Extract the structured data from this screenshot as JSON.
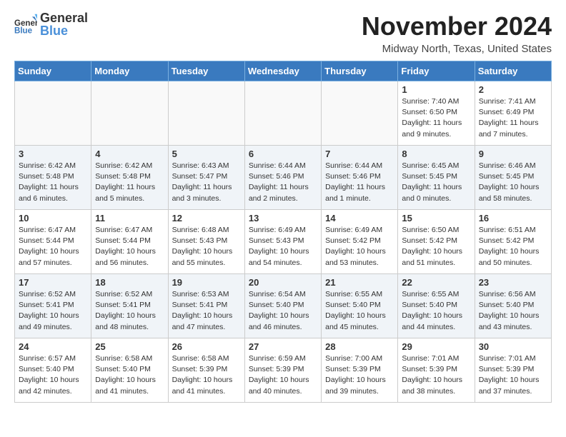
{
  "logo": {
    "line1": "General",
    "line2": "Blue"
  },
  "title": "November 2024",
  "location": "Midway North, Texas, United States",
  "weekdays": [
    "Sunday",
    "Monday",
    "Tuesday",
    "Wednesday",
    "Thursday",
    "Friday",
    "Saturday"
  ],
  "weeks": [
    [
      {
        "day": "",
        "detail": ""
      },
      {
        "day": "",
        "detail": ""
      },
      {
        "day": "",
        "detail": ""
      },
      {
        "day": "",
        "detail": ""
      },
      {
        "day": "",
        "detail": ""
      },
      {
        "day": "1",
        "detail": "Sunrise: 7:40 AM\nSunset: 6:50 PM\nDaylight: 11 hours\nand 9 minutes."
      },
      {
        "day": "2",
        "detail": "Sunrise: 7:41 AM\nSunset: 6:49 PM\nDaylight: 11 hours\nand 7 minutes."
      }
    ],
    [
      {
        "day": "3",
        "detail": "Sunrise: 6:42 AM\nSunset: 5:48 PM\nDaylight: 11 hours\nand 6 minutes."
      },
      {
        "day": "4",
        "detail": "Sunrise: 6:42 AM\nSunset: 5:48 PM\nDaylight: 11 hours\nand 5 minutes."
      },
      {
        "day": "5",
        "detail": "Sunrise: 6:43 AM\nSunset: 5:47 PM\nDaylight: 11 hours\nand 3 minutes."
      },
      {
        "day": "6",
        "detail": "Sunrise: 6:44 AM\nSunset: 5:46 PM\nDaylight: 11 hours\nand 2 minutes."
      },
      {
        "day": "7",
        "detail": "Sunrise: 6:44 AM\nSunset: 5:46 PM\nDaylight: 11 hours\nand 1 minute."
      },
      {
        "day": "8",
        "detail": "Sunrise: 6:45 AM\nSunset: 5:45 PM\nDaylight: 11 hours\nand 0 minutes."
      },
      {
        "day": "9",
        "detail": "Sunrise: 6:46 AM\nSunset: 5:45 PM\nDaylight: 10 hours\nand 58 minutes."
      }
    ],
    [
      {
        "day": "10",
        "detail": "Sunrise: 6:47 AM\nSunset: 5:44 PM\nDaylight: 10 hours\nand 57 minutes."
      },
      {
        "day": "11",
        "detail": "Sunrise: 6:47 AM\nSunset: 5:44 PM\nDaylight: 10 hours\nand 56 minutes."
      },
      {
        "day": "12",
        "detail": "Sunrise: 6:48 AM\nSunset: 5:43 PM\nDaylight: 10 hours\nand 55 minutes."
      },
      {
        "day": "13",
        "detail": "Sunrise: 6:49 AM\nSunset: 5:43 PM\nDaylight: 10 hours\nand 54 minutes."
      },
      {
        "day": "14",
        "detail": "Sunrise: 6:49 AM\nSunset: 5:42 PM\nDaylight: 10 hours\nand 53 minutes."
      },
      {
        "day": "15",
        "detail": "Sunrise: 6:50 AM\nSunset: 5:42 PM\nDaylight: 10 hours\nand 51 minutes."
      },
      {
        "day": "16",
        "detail": "Sunrise: 6:51 AM\nSunset: 5:42 PM\nDaylight: 10 hours\nand 50 minutes."
      }
    ],
    [
      {
        "day": "17",
        "detail": "Sunrise: 6:52 AM\nSunset: 5:41 PM\nDaylight: 10 hours\nand 49 minutes."
      },
      {
        "day": "18",
        "detail": "Sunrise: 6:52 AM\nSunset: 5:41 PM\nDaylight: 10 hours\nand 48 minutes."
      },
      {
        "day": "19",
        "detail": "Sunrise: 6:53 AM\nSunset: 5:41 PM\nDaylight: 10 hours\nand 47 minutes."
      },
      {
        "day": "20",
        "detail": "Sunrise: 6:54 AM\nSunset: 5:40 PM\nDaylight: 10 hours\nand 46 minutes."
      },
      {
        "day": "21",
        "detail": "Sunrise: 6:55 AM\nSunset: 5:40 PM\nDaylight: 10 hours\nand 45 minutes."
      },
      {
        "day": "22",
        "detail": "Sunrise: 6:55 AM\nSunset: 5:40 PM\nDaylight: 10 hours\nand 44 minutes."
      },
      {
        "day": "23",
        "detail": "Sunrise: 6:56 AM\nSunset: 5:40 PM\nDaylight: 10 hours\nand 43 minutes."
      }
    ],
    [
      {
        "day": "24",
        "detail": "Sunrise: 6:57 AM\nSunset: 5:40 PM\nDaylight: 10 hours\nand 42 minutes."
      },
      {
        "day": "25",
        "detail": "Sunrise: 6:58 AM\nSunset: 5:40 PM\nDaylight: 10 hours\nand 41 minutes."
      },
      {
        "day": "26",
        "detail": "Sunrise: 6:58 AM\nSunset: 5:39 PM\nDaylight: 10 hours\nand 41 minutes."
      },
      {
        "day": "27",
        "detail": "Sunrise: 6:59 AM\nSunset: 5:39 PM\nDaylight: 10 hours\nand 40 minutes."
      },
      {
        "day": "28",
        "detail": "Sunrise: 7:00 AM\nSunset: 5:39 PM\nDaylight: 10 hours\nand 39 minutes."
      },
      {
        "day": "29",
        "detail": "Sunrise: 7:01 AM\nSunset: 5:39 PM\nDaylight: 10 hours\nand 38 minutes."
      },
      {
        "day": "30",
        "detail": "Sunrise: 7:01 AM\nSunset: 5:39 PM\nDaylight: 10 hours\nand 37 minutes."
      }
    ]
  ]
}
